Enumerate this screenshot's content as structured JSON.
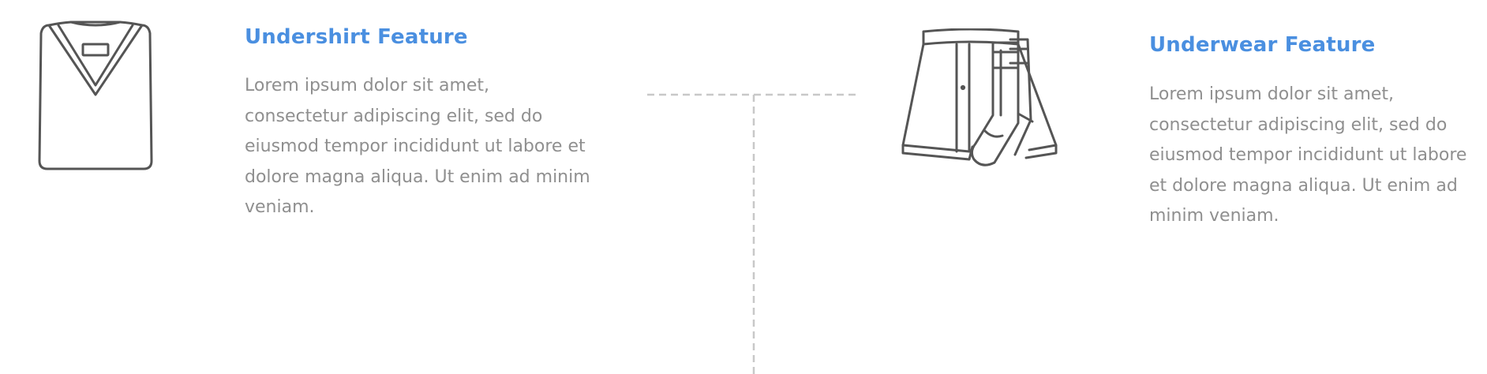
{
  "features": [
    {
      "title": "Undershirt Feature",
      "text": "Lorem ipsum dolor sit amet, consectetur adipiscing elit, sed do eiusmod tempor incididunt ut labore et dolore magna aliqua. Ut enim ad minim veniam.",
      "icon": "undershirt-icon"
    },
    {
      "title": "Underwear Feature",
      "text": "Lorem ipsum dolor sit amet, consectetur adipiscing elit, sed do eiusmod tempor incididunt ut labore et dolore magna aliqua. Ut enim ad minim veniam.",
      "icon": "underwear-socks-icon"
    }
  ],
  "colors": {
    "title": "#4a8fe0",
    "text": "#8f8f8f",
    "icon_stroke": "#555555",
    "connector": "#c8c8c8"
  }
}
